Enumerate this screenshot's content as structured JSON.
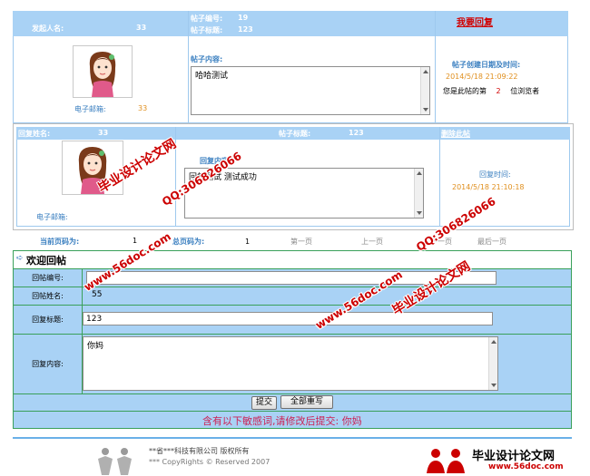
{
  "post": {
    "initiator_label": "发起人名:",
    "initiator_value": "33",
    "post_id_label": "帖子编号:",
    "post_id_value": "19",
    "post_title_label": "帖子标题:",
    "post_title_value": "123",
    "reply_link": "我要回复",
    "content_label": "帖子内容:",
    "content_text": "哈哈测试",
    "email_label": "电子邮箱:",
    "email_value": "33",
    "created_label": "帖子创建日期及时间:",
    "created_value": "2014/5/18 21:09:22",
    "viewer_prefix": "您是此帖的第",
    "viewer_count": "2",
    "viewer_suffix": "位浏览者"
  },
  "reply": {
    "name_label": "回复姓名:",
    "name_value": "33",
    "title_label": "帖子标题:",
    "title_value": "123",
    "delete_link": "删除此帖",
    "content_label": "回复内容:",
    "content_text": "回复测试 测试成功",
    "email_label": "电子邮箱:",
    "time_label": "回复时间:",
    "time_value": "2014/5/18 21:10:18"
  },
  "pagination": {
    "current_label": "当前页码为:",
    "current_value": "1",
    "total_label": "总页码为:",
    "total_value": "1",
    "first": "第一页",
    "prev": "上一页",
    "next": "下一页",
    "last": "最后一页"
  },
  "form": {
    "title": "欢迎回帖",
    "post_no_label": "回帖编号:",
    "post_no_value": "",
    "poster_label": "回帖姓名:",
    "poster_value": "55",
    "reply_title_label": "回复标题:",
    "reply_title_value": "123",
    "reply_content_label": "回复内容:",
    "reply_content_value": "你妈",
    "submit": "提交",
    "reset": "全部重写",
    "warning": "含有以下敏感词,请修改后提交: 你妈"
  },
  "footer": {
    "copyright": "**省***科技有限公司 版权所有",
    "copyright2": "***  CopyRights © Reserved 2007"
  },
  "watermarks": {
    "site": "www.56doc.com",
    "name": "毕业设计论文网",
    "qq": "QQ:306826066",
    "logo_title": "毕业设计论文网",
    "logo_url": "www.56doc.com"
  },
  "colors": {
    "header_blue": "#a9d2f5",
    "border_blue": "#9ec9ee",
    "label_blue": "#3a7fc0",
    "orange": "#e09020",
    "red_link": "#d10000",
    "form_border": "#3aa05a",
    "warning": "#cc2255"
  }
}
